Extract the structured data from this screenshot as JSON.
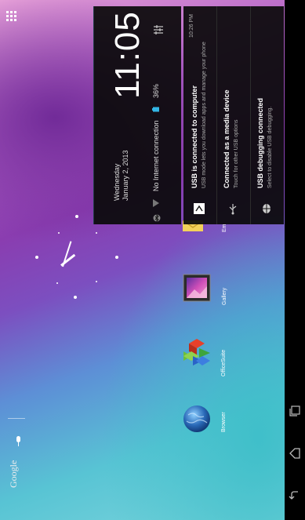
{
  "search": {
    "google_label": "Google"
  },
  "clock": {
    "time": "11:05"
  },
  "date": {
    "weekday": "Wednesday",
    "full": "January 2, 2013"
  },
  "status": {
    "connection": "No Internet connection",
    "battery": "36%"
  },
  "apps": [
    {
      "label": "Browser",
      "icon": "globe-icon"
    },
    {
      "label": "OfficeSuite",
      "icon": "officesuite-icon"
    },
    {
      "label": "Gallery",
      "icon": "gallery-icon"
    },
    {
      "label": "Em",
      "icon": "email-icon"
    }
  ],
  "notifications": [
    {
      "title": "USB is connected to computer",
      "subtitle": "USB mode lets you download apps and manage your phone",
      "time": "10:26 PM",
      "icon": "usb-computer-icon"
    },
    {
      "title": "Connected as a media device",
      "subtitle": "Touch for other USB options",
      "time": "",
      "icon": "usb-icon"
    },
    {
      "title": "USB debugging connected",
      "subtitle": "Select to disable USB debugging.",
      "time": "",
      "icon": "android-debug-icon"
    }
  ],
  "colors": {
    "panel_bg": "#0a0a0a",
    "accent": "#33b5e5"
  }
}
